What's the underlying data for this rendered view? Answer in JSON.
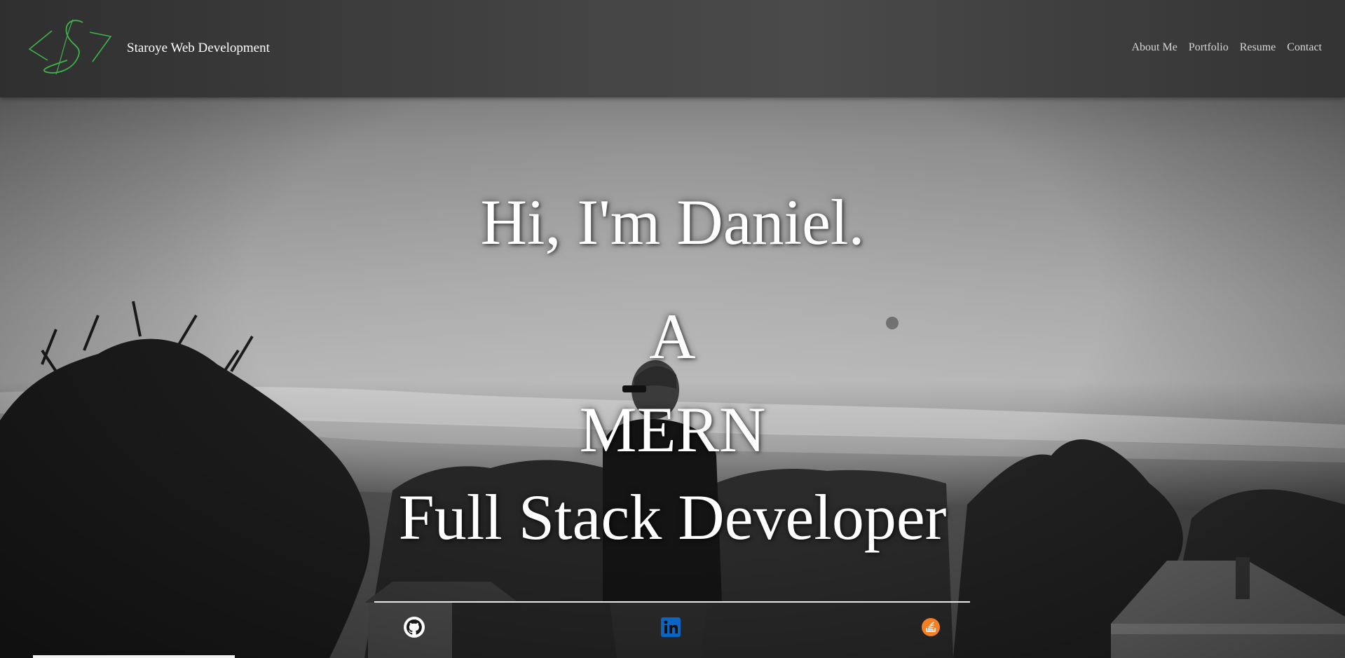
{
  "header": {
    "brand": "Staroye Web Development",
    "logo_icon": "staroye-logo-icon",
    "logo_color": "#3db44a",
    "nav": [
      {
        "label": "About Me"
      },
      {
        "label": "Portfolio"
      },
      {
        "label": "Resume"
      },
      {
        "label": "Contact"
      }
    ]
  },
  "hero": {
    "greeting": "Hi, I'm Daniel.",
    "role_lines": [
      "A",
      "MERN",
      "Full Stack Developer"
    ]
  },
  "social": [
    {
      "icon": "github-icon",
      "color": "#ffffff"
    },
    {
      "icon": "linkedin-icon",
      "color": "#0a66c2"
    },
    {
      "icon": "stackoverflow-icon",
      "color": "#f48024"
    }
  ]
}
